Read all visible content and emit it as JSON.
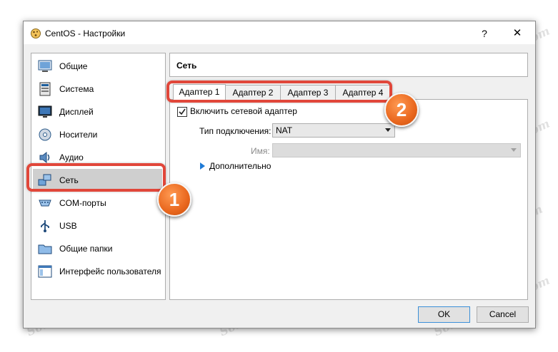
{
  "window": {
    "title": "CentOS - Настройки",
    "help_label": "?",
    "close_label": "✕"
  },
  "sidebar": {
    "items": [
      {
        "label": "Общие",
        "icon": "general-icon"
      },
      {
        "label": "Система",
        "icon": "system-icon"
      },
      {
        "label": "Дисплей",
        "icon": "display-icon"
      },
      {
        "label": "Носители",
        "icon": "storage-icon"
      },
      {
        "label": "Аудио",
        "icon": "audio-icon"
      },
      {
        "label": "Сеть",
        "icon": "network-icon",
        "selected": true
      },
      {
        "label": "COM-порты",
        "icon": "serial-ports-icon"
      },
      {
        "label": "USB",
        "icon": "usb-icon"
      },
      {
        "label": "Общие папки",
        "icon": "shared-folders-icon"
      },
      {
        "label": "Интерфейс пользователя",
        "icon": "user-interface-icon"
      }
    ]
  },
  "main": {
    "header": "Сеть",
    "tabs": [
      {
        "label": "Адаптер 1",
        "active": true
      },
      {
        "label": "Адаптер 2"
      },
      {
        "label": "Адаптер 3"
      },
      {
        "label": "Адаптер 4"
      }
    ],
    "enable_adapter": {
      "label": "Включить сетевой адаптер",
      "checked": true
    },
    "attached_to": {
      "label": "Тип подключения:",
      "value": "NAT"
    },
    "name": {
      "label": "Имя:",
      "value": ""
    },
    "advanced_label": "Дополнительно"
  },
  "buttons": {
    "ok": "OK",
    "cancel": "Cancel"
  },
  "annotations": {
    "badge1": "1",
    "badge2": "2",
    "color": "#e1473a"
  },
  "watermark": "Soringpcrepair.com"
}
